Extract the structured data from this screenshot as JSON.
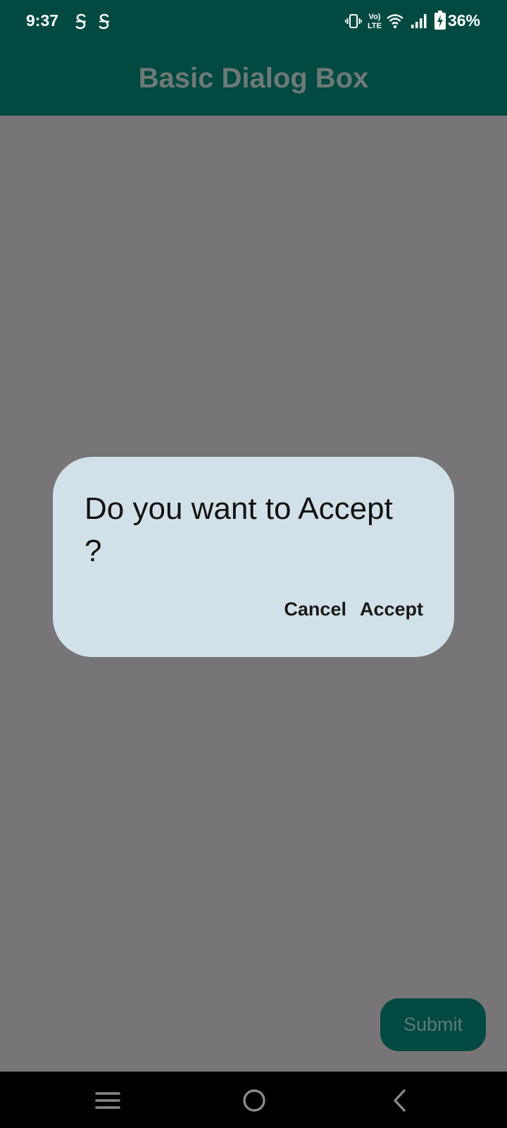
{
  "status_bar": {
    "time": "9:37",
    "battery_percent": "36%",
    "notification_icons": [
      "carrier-s-icon",
      "carrier-s-icon"
    ],
    "right_icons": [
      "vibrate-icon",
      "volte-icon",
      "wifi-icon",
      "signal-icon",
      "battery-charging-icon"
    ]
  },
  "app_bar": {
    "title": "Basic Dialog Box"
  },
  "dialog": {
    "message": "Do you want to Accept ?",
    "cancel_label": "Cancel",
    "accept_label": "Accept"
  },
  "fab": {
    "label": "Submit"
  },
  "nav_bar": {
    "icons": [
      "menu-icon",
      "home-icon",
      "back-icon"
    ]
  },
  "colors": {
    "app_bar": "#024a41",
    "scrim_background": "#787578",
    "dialog_background": "#d2e1e8",
    "nav_bar": "#000000"
  }
}
